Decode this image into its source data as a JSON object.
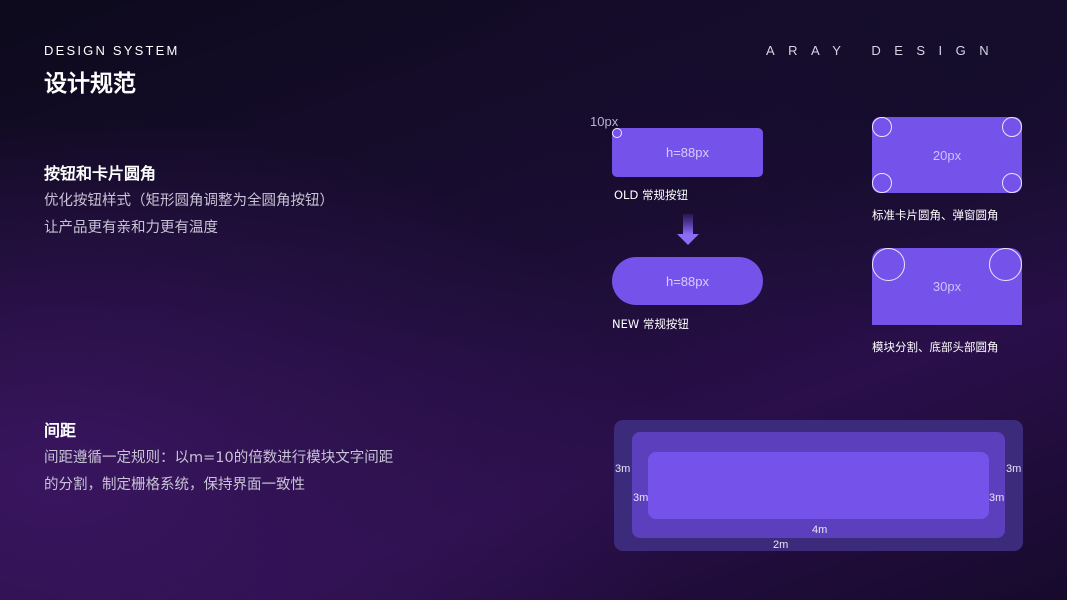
{
  "header": {
    "subtitle_en": "DESIGN SYSTEM",
    "title": "设计规范",
    "brand": "ARAY DESIGN"
  },
  "corner_section": {
    "title": "按钮和卡片圆角",
    "desc_line1": "优化按钮样式（矩形圆角调整为全圆角按钮）",
    "desc_line2": "让产品更有亲和力更有温度"
  },
  "spacing_section": {
    "title": "间距",
    "desc_line1": "间距遵循一定规则：以m=10的倍数进行模块文字间距",
    "desc_line2": "的分割，制定栅格系统，保持界面一致性"
  },
  "buttons_demo": {
    "radius_label": "10px",
    "old_button_text": "h=88px",
    "old_caption": "OLD 常规按钮",
    "new_button_text": "h=88px",
    "new_caption": "NEW 常规按钮",
    "arrow_icon": "arrow-down-icon"
  },
  "cards_demo": {
    "card1_text": "20px",
    "card1_caption": "标准卡片圆角、弹窗圆角",
    "card2_text": "30px",
    "card2_caption": "模块分割、底部头部圆角"
  },
  "spacing_demo": {
    "outer_left": "3m",
    "outer_right": "3m",
    "inner_left": "3m",
    "inner_right": "3m",
    "inner_bottom": "4m",
    "outer_bottom": "2m"
  },
  "colors": {
    "accent": "#7553ea",
    "layer_outer": "#3c2a7a",
    "layer_middle": "#5b3fbd",
    "layer_inner": "#7553ea"
  }
}
